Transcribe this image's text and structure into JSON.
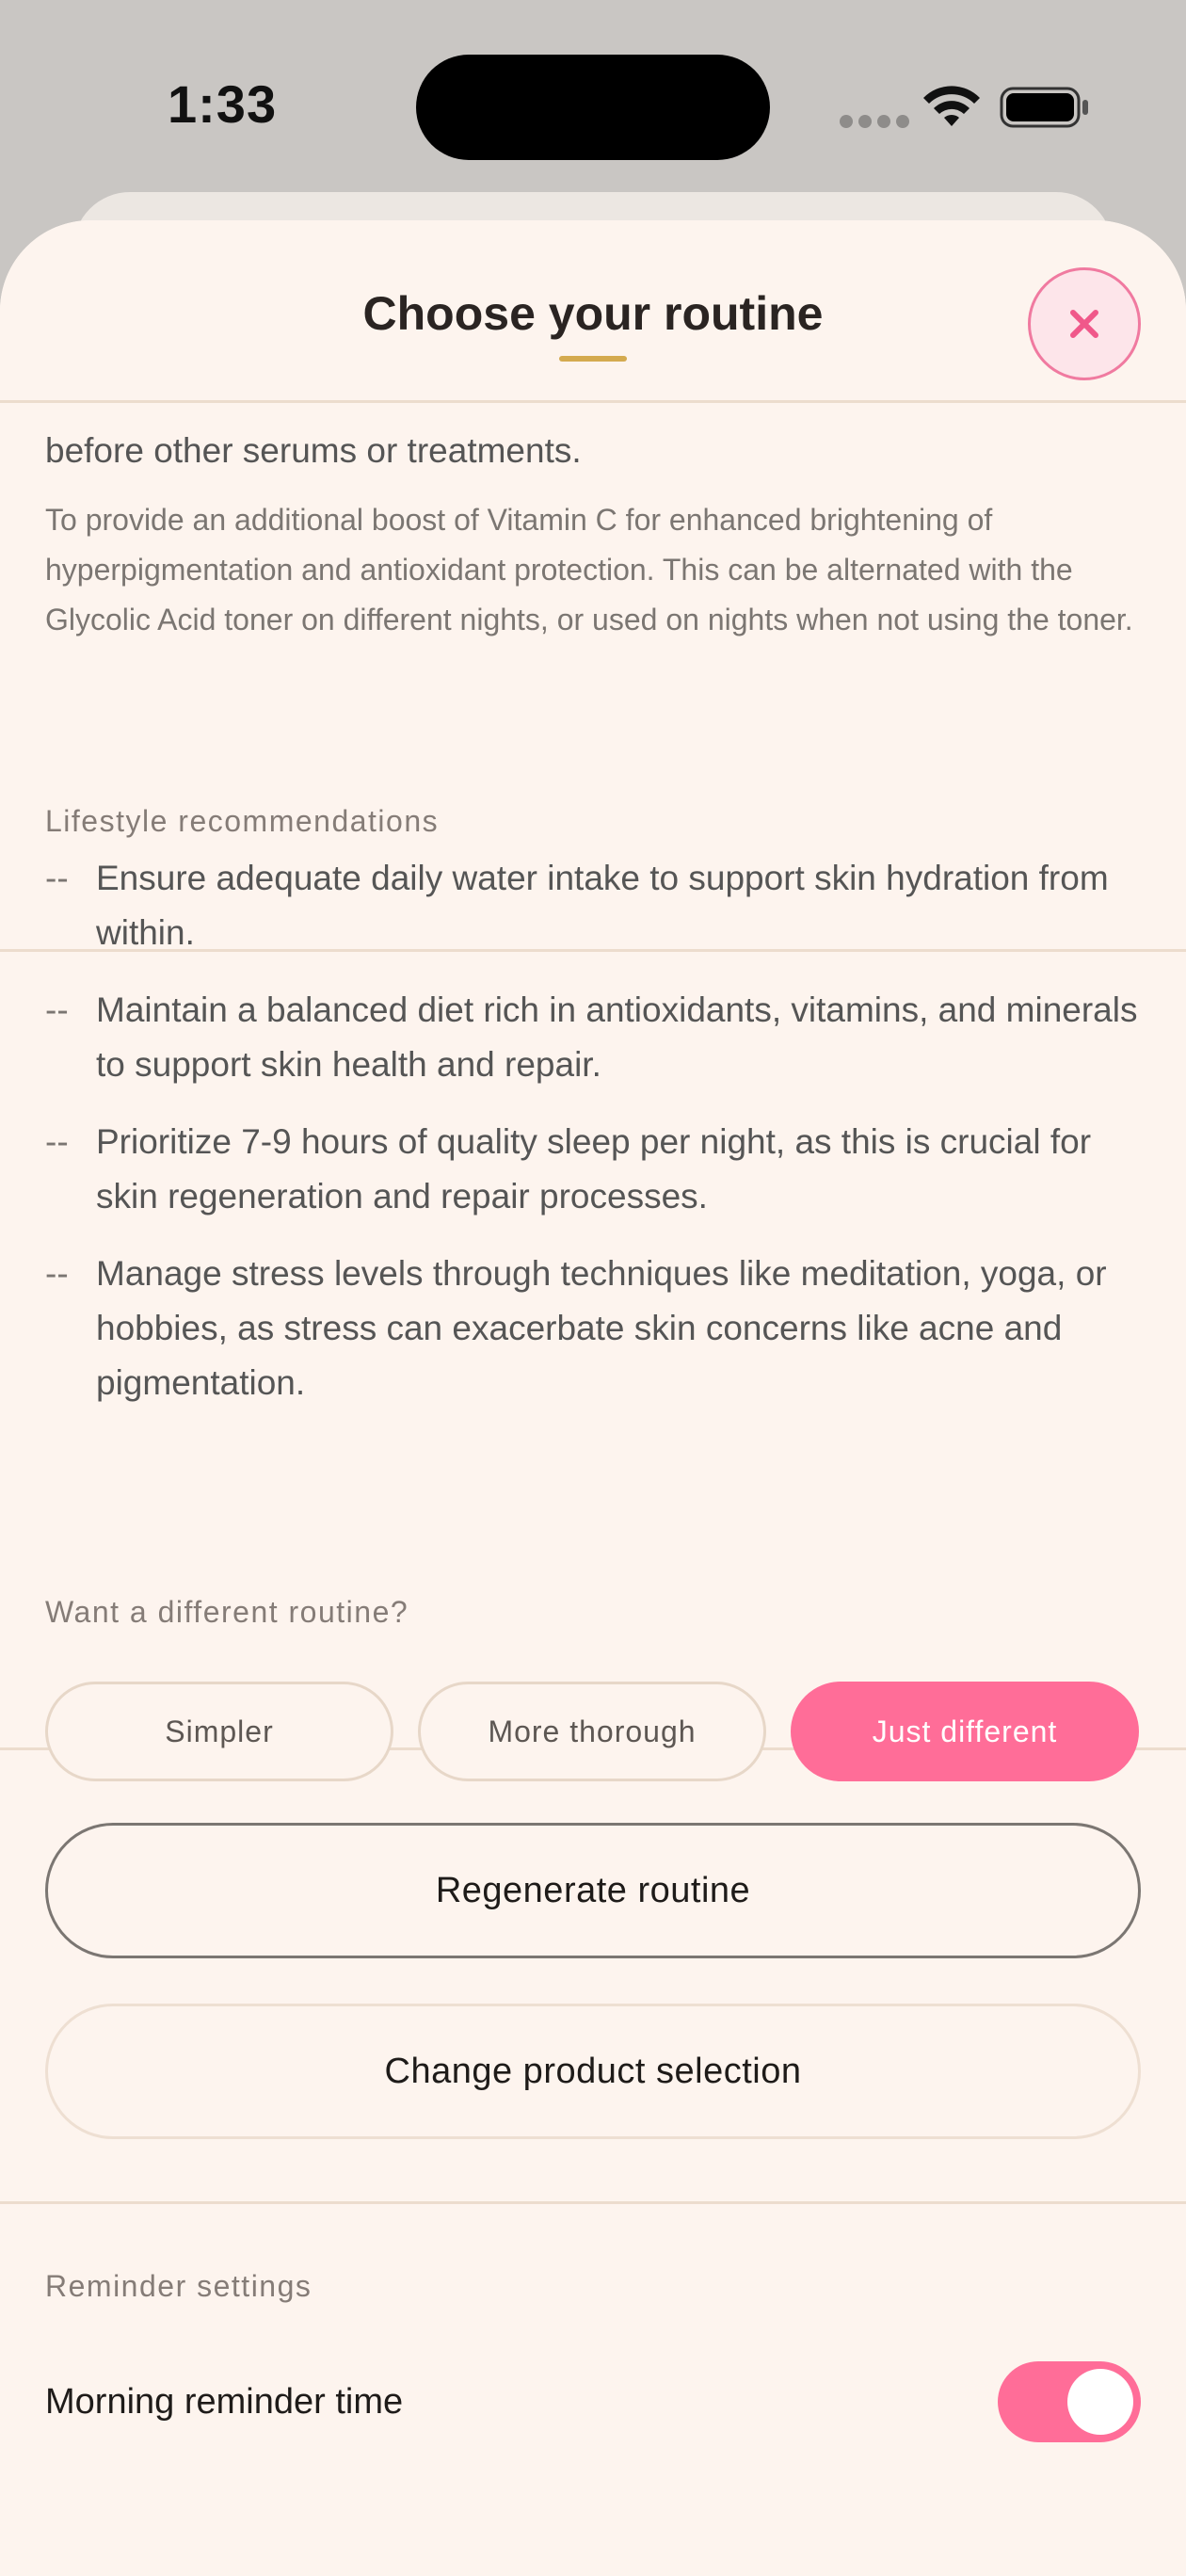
{
  "status_bar": {
    "time": "1:33"
  },
  "sheet": {
    "title": "Choose your routine"
  },
  "routine_step": {
    "cut_text": "before other serums or treatments.",
    "note": "To provide an additional boost of Vitamin C for enhanced brightening of hyperpigmentation and antioxidant protection. This can be alternated with the Glycolic Acid toner on different nights, or used on nights when not using the toner."
  },
  "lifestyle": {
    "label": "Lifestyle recommendations",
    "bullet_marker": "--",
    "items": [
      "Ensure adequate daily water intake to support skin hydration from within.",
      "Maintain a balanced diet rich in antioxidants, vitamins, and minerals to support skin health and repair.",
      "Prioritize 7-9 hours of quality sleep per night, as this is crucial for skin regeneration and repair processes.",
      "Manage stress levels through techniques like meditation, yoga, or hobbies, as stress can exacerbate skin concerns like acne and pigmentation."
    ]
  },
  "different_routine": {
    "label": "Want a different routine?",
    "options": [
      "Simpler",
      "More thorough",
      "Just different"
    ],
    "selected": "Just different",
    "regenerate_label": "Regenerate routine",
    "change_products_label": "Change product selection"
  },
  "reminders": {
    "label": "Reminder settings",
    "morning_label": "Morning reminder time",
    "morning_enabled": true
  },
  "colors": {
    "accent_pink": "#ff6d98",
    "title_underline": "#d4aa4f",
    "sheet_bg": "#fdf4ee"
  }
}
